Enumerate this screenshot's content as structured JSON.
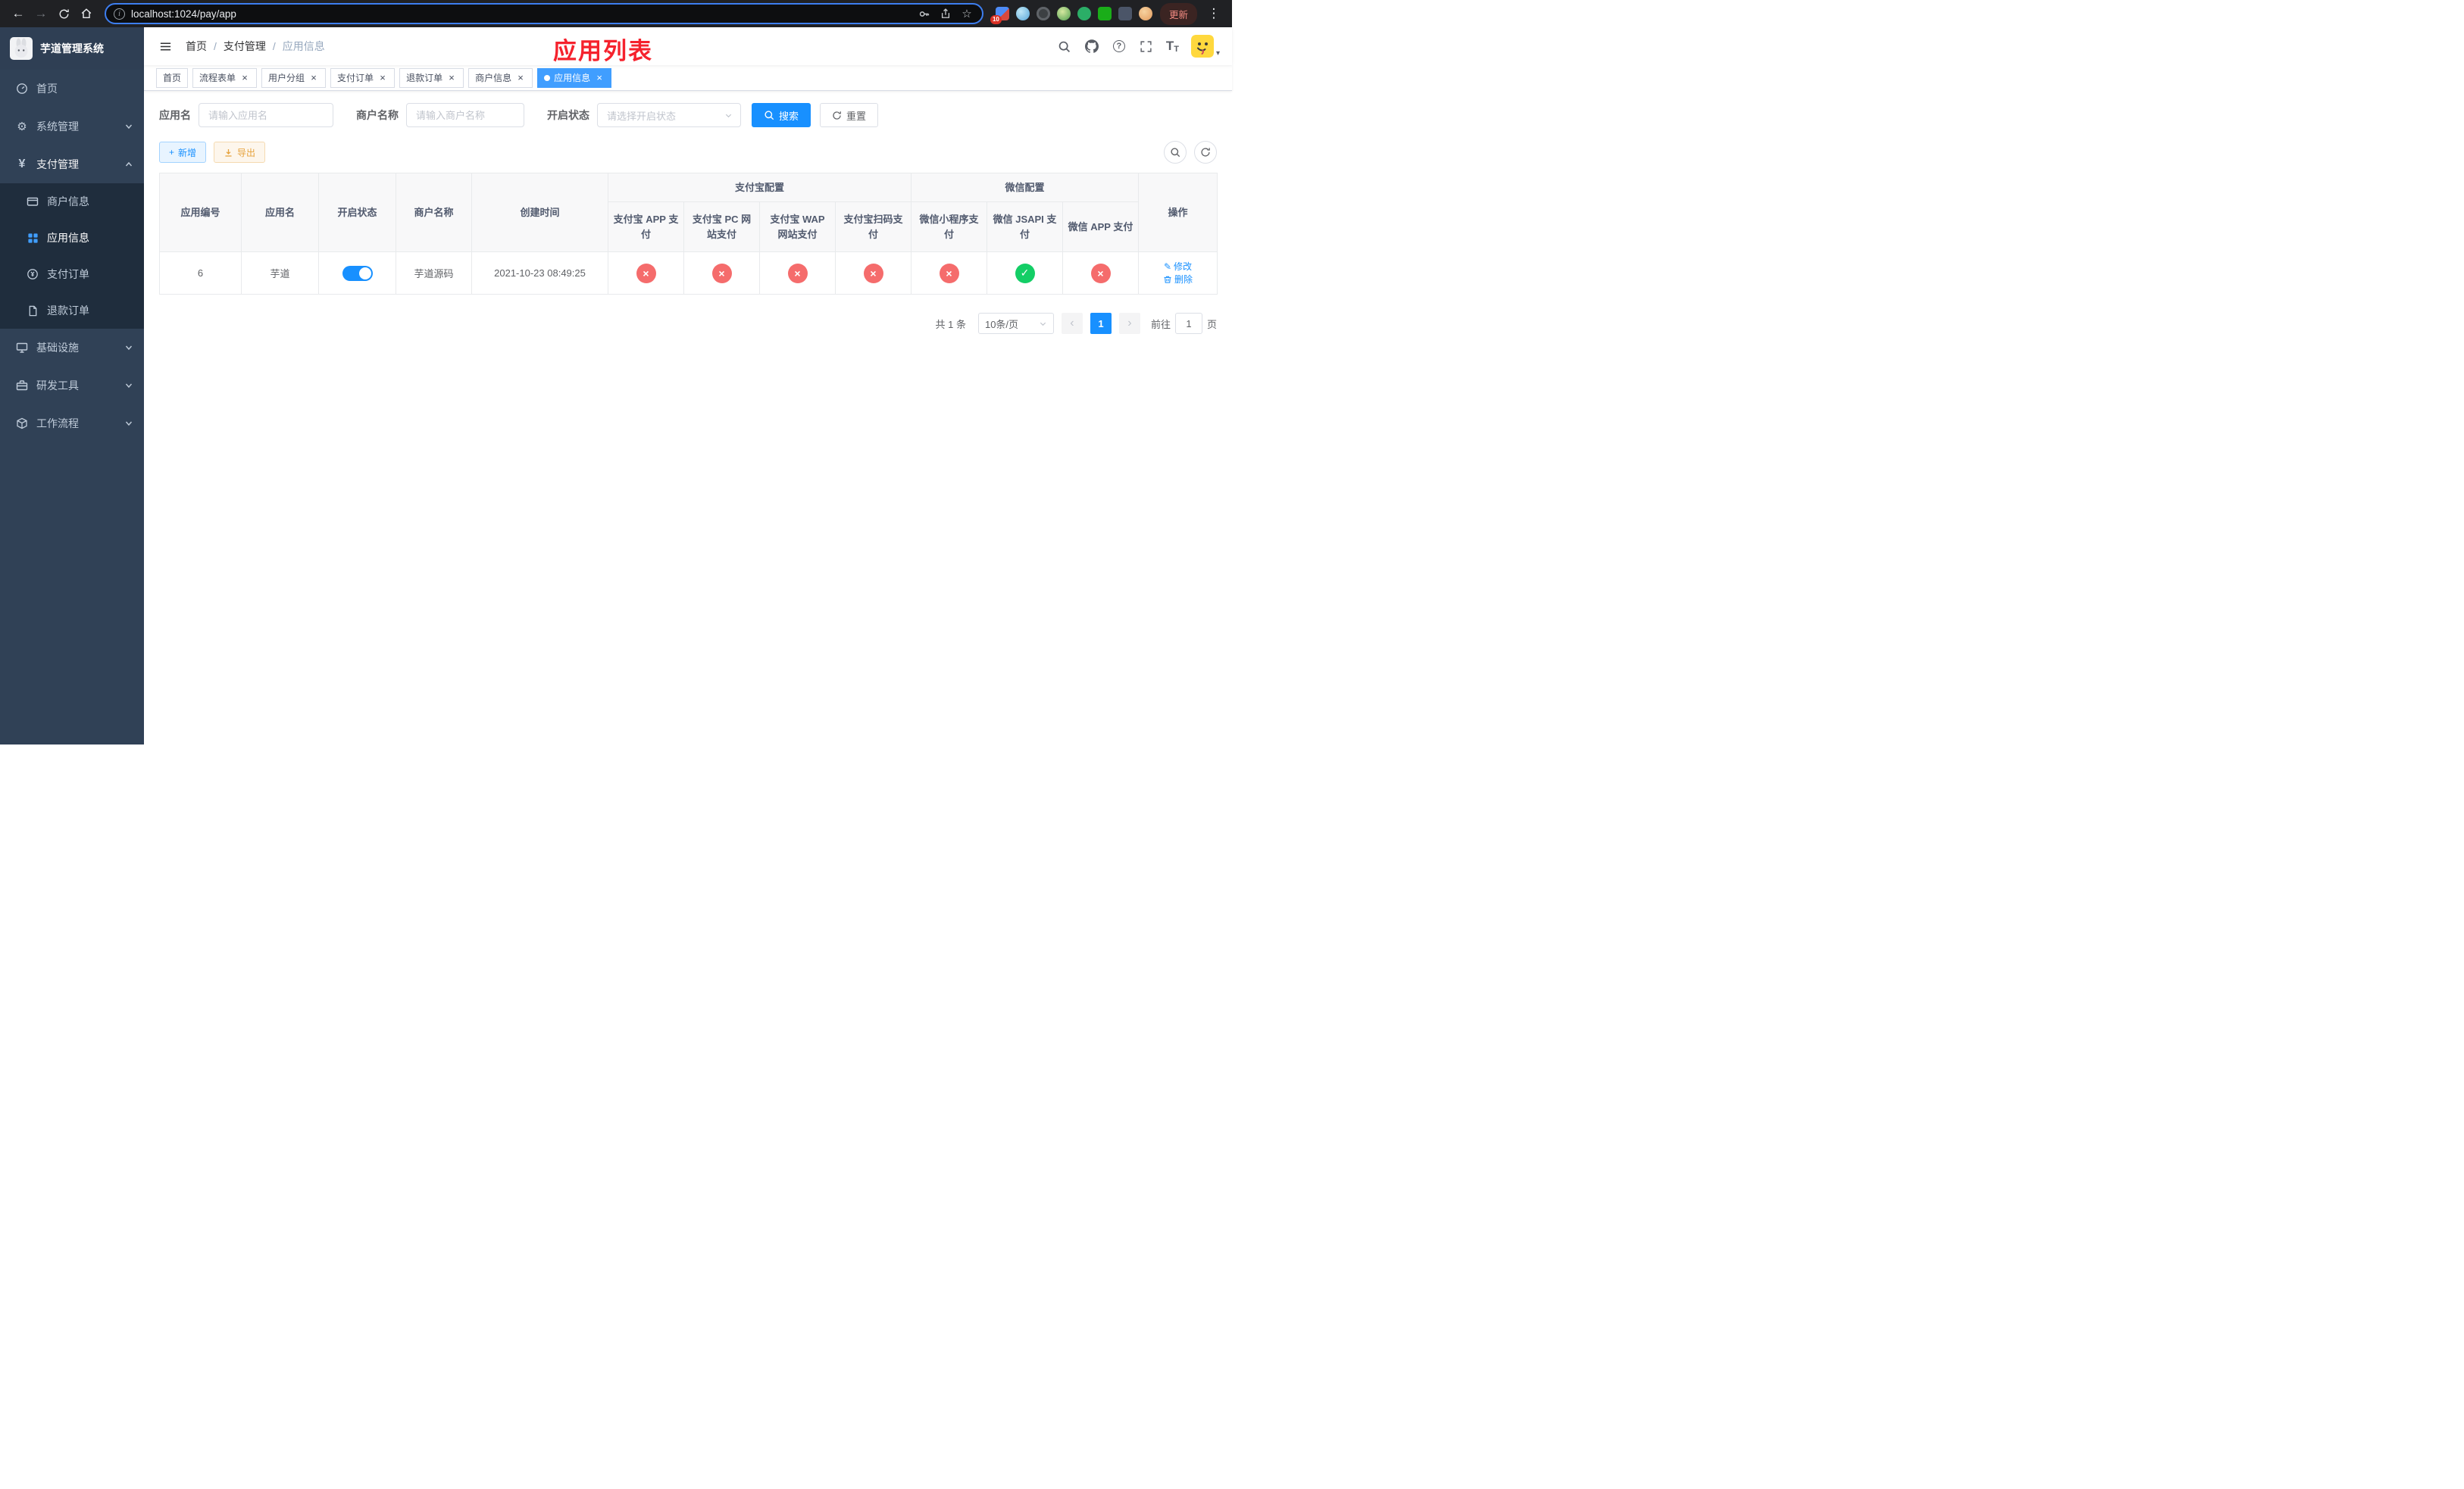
{
  "colors": {
    "accent": "#1890ff",
    "menu_active": "#409eff",
    "danger": "#f56c6c",
    "success": "#13ce66",
    "warning": "#e6a23c",
    "annotation_red": "#f5222d",
    "sidebar_bg": "#304156"
  },
  "icons": {
    "back": "←",
    "forward": "→",
    "star": "☆",
    "menu_dots": "⋮",
    "info": "i",
    "question": "?",
    "font_size": "T",
    "close": "×",
    "check": "✓",
    "cross": "×",
    "plus": "+",
    "prev": "‹",
    "next": "›",
    "caret": "▾",
    "slash": "/",
    "yen": "¥",
    "edit": "✎"
  },
  "browser": {
    "url": "localhost:1024/pay/app",
    "update_label": "更新",
    "extension_badge": "10"
  },
  "sidebar": {
    "title": "芋道管理系统",
    "home": "首页",
    "system": "系统管理",
    "payment": "支付管理",
    "merchant_info": "商户信息",
    "app_info": "应用信息",
    "pay_order": "支付订单",
    "refund_order": "退款订单",
    "infra": "基础设施",
    "dev_tools": "研发工具",
    "workflow": "工作流程"
  },
  "header": {
    "breadcrumb": [
      "首页",
      "支付管理",
      "应用信息"
    ],
    "annotation": "应用列表"
  },
  "tabs": [
    {
      "label": "首页"
    },
    {
      "label": "流程表单"
    },
    {
      "label": "用户分组"
    },
    {
      "label": "支付订单"
    },
    {
      "label": "退款订单"
    },
    {
      "label": "商户信息"
    },
    {
      "label": "应用信息"
    }
  ],
  "filters": {
    "app_name_label": "应用名",
    "app_name_placeholder": "请输入应用名",
    "merchant_label": "商户名称",
    "merchant_placeholder": "请输入商户名称",
    "status_label": "开启状态",
    "status_placeholder": "请选择开启状态",
    "search_label": "搜索",
    "reset_label": "重置"
  },
  "toolbar": {
    "add_label": "新增",
    "export_label": "导出"
  },
  "table": {
    "groups": {
      "alipay": "支付宝配置",
      "wechat": "微信配置"
    },
    "columns": {
      "app_id": "应用编号",
      "app_name": "应用名",
      "status": "开启状态",
      "merchant": "商户名称",
      "create_time": "创建时间",
      "alipay_app": "支付宝 APP 支付",
      "alipay_pc": "支付宝 PC 网站支付",
      "alipay_wap": "支付宝 WAP 网站支付",
      "alipay_qr": "支付宝扫码支付",
      "wx_lite": "微信小程序支付",
      "wx_jsapi": "微信 JSAPI 支付",
      "wx_app": "微信 APP 支付",
      "actions": "操作"
    },
    "row": {
      "app_id": "6",
      "app_name": "芋道",
      "status_enabled": true,
      "merchant": "芋道源码",
      "create_time": "2021-10-23 08:49:25",
      "alipay_app": false,
      "alipay_pc": false,
      "alipay_wap": false,
      "alipay_qr": false,
      "wx_lite": false,
      "wx_jsapi": true,
      "wx_app": false,
      "edit_label": "修改",
      "delete_label": "删除"
    }
  },
  "pagination": {
    "total": "共 1 条",
    "page_size": "10条/页",
    "page": "1",
    "goto_label": "前往",
    "goto_value": "1",
    "page_unit": "页"
  }
}
